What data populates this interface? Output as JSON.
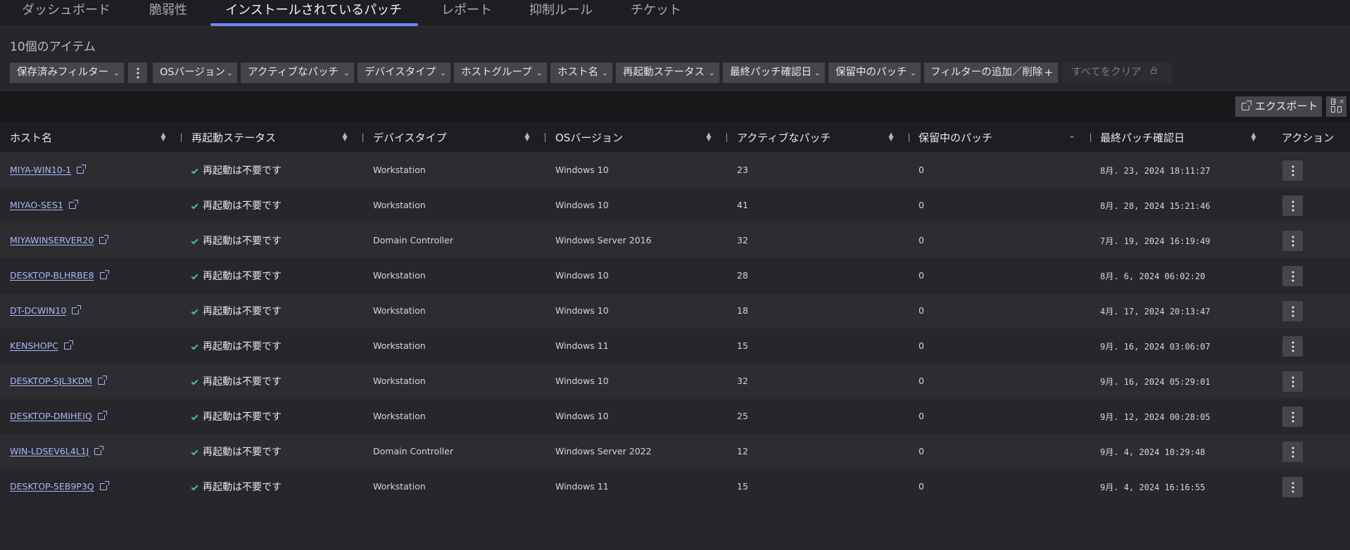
{
  "tabs": [
    {
      "label": "ダッシュボード"
    },
    {
      "label": "脆弱性"
    },
    {
      "label": "インストールされているパッチ",
      "active": true
    },
    {
      "label": "レポート"
    },
    {
      "label": "抑制ルール"
    },
    {
      "label": "チケット"
    }
  ],
  "item_count": "10個のアイテム",
  "filters": {
    "saved": "保存済みフィルター",
    "os_version": "OSバージョン",
    "active_patch": "アクティブなパッチ",
    "device_type": "デバイスタイプ",
    "host_group": "ホストグループ",
    "host_name": "ホスト名",
    "restart_status": "再起動ステータス",
    "last_patch_check": "最終パッチ確認日",
    "pending_patch": "保留中のパッチ",
    "add_remove": "フィルターの追加／削除",
    "add_icon": "+",
    "clear_all": "すべてをクリア"
  },
  "toolbar": {
    "export_label": "エクスポート"
  },
  "table": {
    "columns": [
      "ホスト名",
      "再起動ステータス",
      "デバイスタイプ",
      "OSバージョン",
      "アクティブなパッチ",
      "保留中のパッチ",
      "最終パッチ確認日",
      "アクション"
    ],
    "rows": [
      {
        "host": "MIYA-WIN10-1",
        "restart": "再起動は不要です",
        "device": "Workstation",
        "os": "Windows 10",
        "active": "23",
        "pending": "0",
        "last": "8月. 23, 2024 18:11:27"
      },
      {
        "host": "MIYAO-SES1",
        "restart": "再起動は不要です",
        "device": "Workstation",
        "os": "Windows 10",
        "active": "41",
        "pending": "0",
        "last": "8月. 28, 2024 15:21:46"
      },
      {
        "host": "MIYAWINSERVER20",
        "restart": "再起動は不要です",
        "device": "Domain Controller",
        "os": "Windows Server 2016",
        "active": "32",
        "pending": "0",
        "last": "7月. 19, 2024 16:19:49"
      },
      {
        "host": "DESKTOP-BLHRBE8",
        "restart": "再起動は不要です",
        "device": "Workstation",
        "os": "Windows 10",
        "active": "28",
        "pending": "0",
        "last": "8月. 6, 2024 06:02:20"
      },
      {
        "host": "DT-DCWIN10",
        "restart": "再起動は不要です",
        "device": "Workstation",
        "os": "Windows 10",
        "active": "18",
        "pending": "0",
        "last": "4月. 17, 2024 20:13:47"
      },
      {
        "host": "KENSHOPC",
        "restart": "再起動は不要です",
        "device": "Workstation",
        "os": "Windows 11",
        "active": "15",
        "pending": "0",
        "last": "9月. 16, 2024 03:06:07"
      },
      {
        "host": "DESKTOP-SJL3KDM",
        "restart": "再起動は不要です",
        "device": "Workstation",
        "os": "Windows 10",
        "active": "32",
        "pending": "0",
        "last": "9月. 16, 2024 05:29:01"
      },
      {
        "host": "DESKTOP-DMIHEIQ",
        "restart": "再起動は不要です",
        "device": "Workstation",
        "os": "Windows 10",
        "active": "25",
        "pending": "0",
        "last": "9月. 12, 2024 00:28:05"
      },
      {
        "host": "WIN-LDSEV6L4L1J",
        "restart": "再起動は不要です",
        "device": "Domain Controller",
        "os": "Windows Server 2022",
        "active": "12",
        "pending": "0",
        "last": "9月. 4, 2024 10:29:48"
      },
      {
        "host": "DESKTOP-5EB9P3Q",
        "restart": "再起動は不要です",
        "device": "Workstation",
        "os": "Windows 11",
        "active": "15",
        "pending": "0",
        "last": "9月. 4, 2024 16:16:55"
      }
    ]
  },
  "icons": {
    "external_link": "external-link-icon",
    "check": "check-icon",
    "kebab": "kebab-menu-icon",
    "sort": "sort-icon",
    "export": "export-icon",
    "columns": "column-toggle-icon",
    "lock": "lock-icon"
  },
  "colors": {
    "accent": "#6e86ff",
    "link": "#aab8f6",
    "success": "#3ec98d"
  }
}
